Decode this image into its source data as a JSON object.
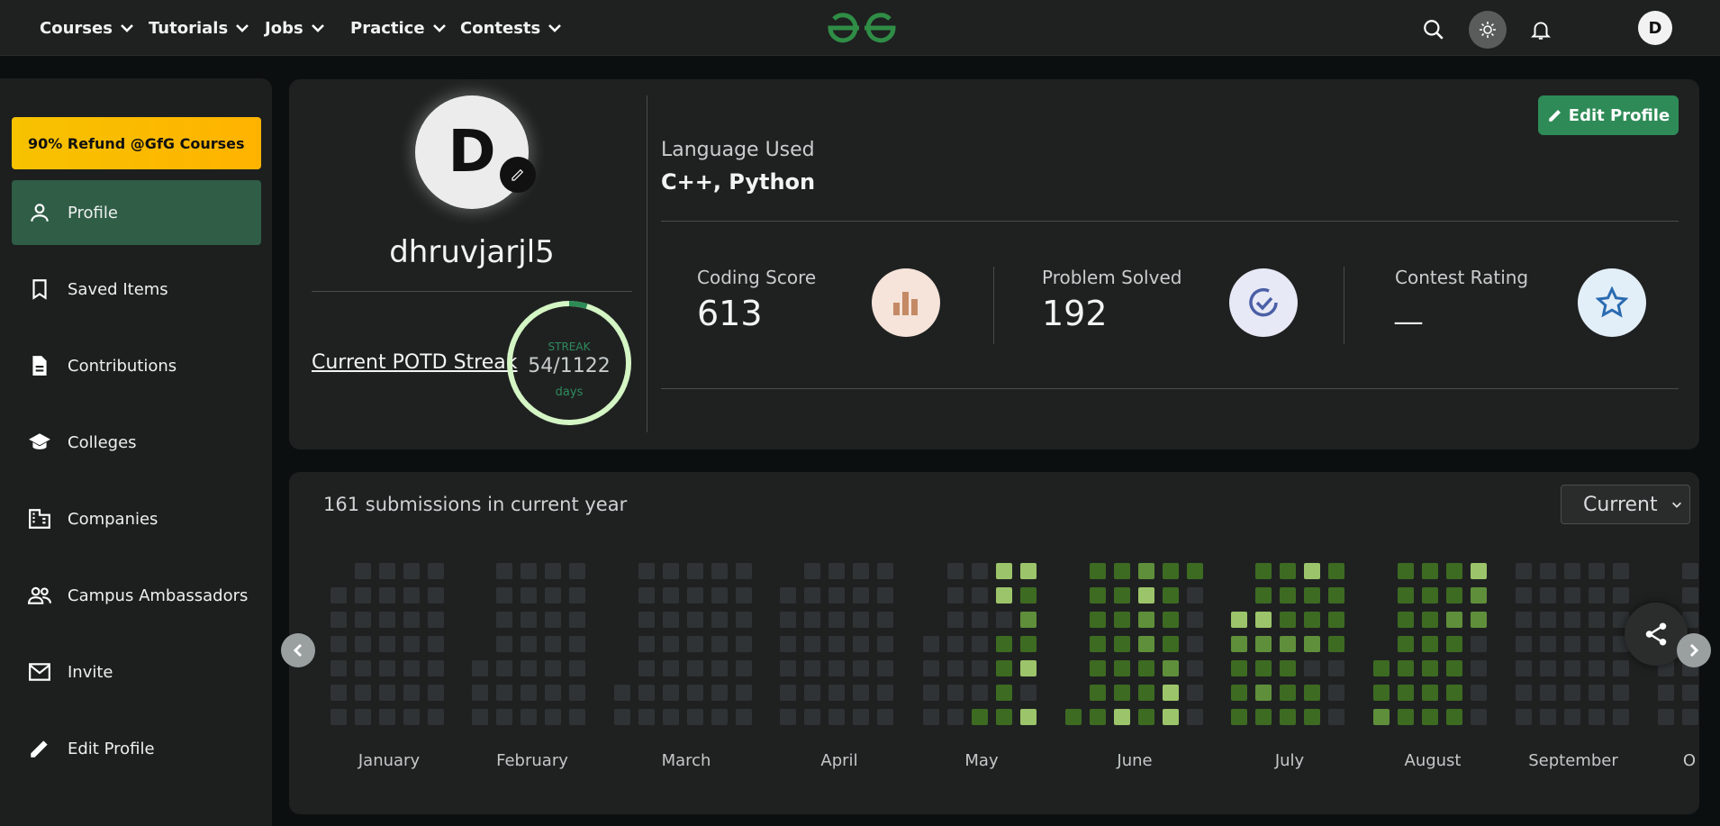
{
  "nav": {
    "items": [
      {
        "label": "Courses"
      },
      {
        "label": "Tutorials"
      },
      {
        "label": "Jobs"
      },
      {
        "label": "Practice"
      },
      {
        "label": "Contests"
      }
    ],
    "logo_icon": "gfg-logo",
    "avatar_initial": "D"
  },
  "sidebar": {
    "promo": "90% Refund @GfG Courses",
    "items": [
      {
        "label": "Profile",
        "icon": "person-icon",
        "active": true
      },
      {
        "label": "Saved Items",
        "icon": "bookmark-icon"
      },
      {
        "label": "Contributions",
        "icon": "document-icon"
      },
      {
        "label": "Colleges",
        "icon": "graduation-cap-icon"
      },
      {
        "label": "Companies",
        "icon": "building-icon"
      },
      {
        "label": "Campus Ambassadors",
        "icon": "people-icon"
      },
      {
        "label": "Invite",
        "icon": "mail-icon"
      },
      {
        "label": "Edit Profile",
        "icon": "pencil-icon"
      }
    ]
  },
  "profile": {
    "avatar_initial": "D",
    "username": "dhruvjarjl5",
    "potd_link": "Current POTD Streak",
    "streak": {
      "label": "STREAK",
      "value": "54/1122",
      "unit": "days",
      "progress": 0.048
    },
    "edit_button": "Edit Profile",
    "language_label": "Language Used",
    "language_value": "C++, Python",
    "stats": [
      {
        "label": "Coding Score",
        "value": "613",
        "icon": "bar-chart-icon"
      },
      {
        "label": "Problem Solved",
        "value": "192",
        "icon": "check-circle-icon"
      },
      {
        "label": "Contest Rating",
        "value": "__",
        "icon": "star-icon"
      }
    ]
  },
  "heatmap": {
    "summary": "161 submissions in current year",
    "select_value": "Current",
    "months": [
      "January",
      "February",
      "March",
      "April",
      "May",
      "June",
      "July",
      "August",
      "September",
      "O"
    ],
    "colors": {
      "empty": "#2f3335",
      "level1": "#3d6b22",
      "level2": "#5f8f3a",
      "level3": "#9cc46a"
    }
  },
  "colors": {
    "accent": "#2e8b57",
    "promo": "#f7c200",
    "sidebar_active": "#2f5d46"
  }
}
